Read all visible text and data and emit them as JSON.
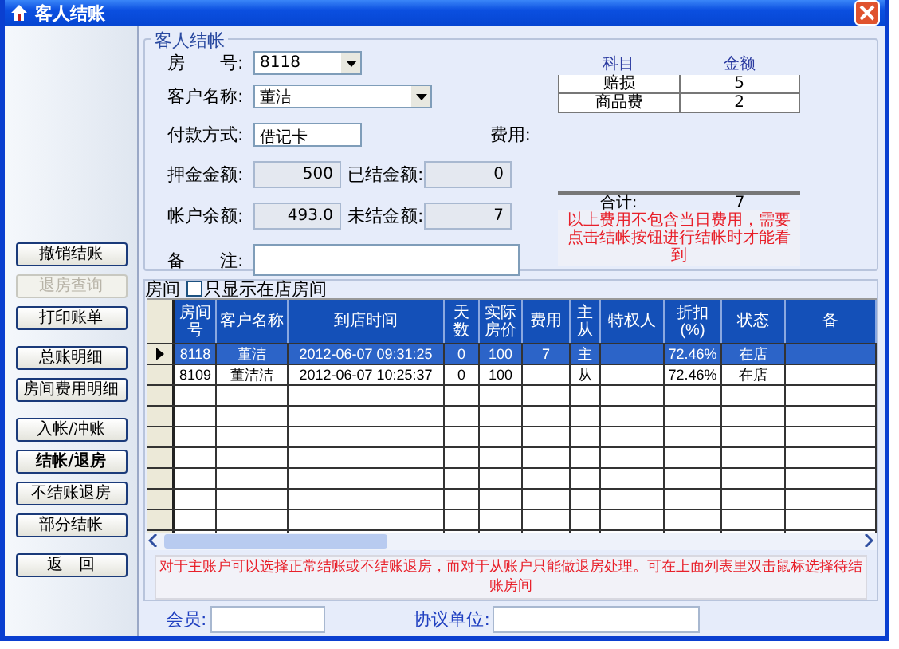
{
  "window": {
    "title": "客人结账"
  },
  "action_groups": [
    [
      {
        "label": "撤销结账",
        "disabled": false,
        "default": false
      },
      {
        "label": "退房查询",
        "disabled": true,
        "default": false
      },
      {
        "label": "打印账单",
        "disabled": false,
        "default": false
      }
    ],
    [
      {
        "label": "总账明细",
        "disabled": false,
        "default": false
      },
      {
        "label": "房间费用明细",
        "disabled": false,
        "default": false
      }
    ],
    [
      {
        "label": "入帐/冲账",
        "disabled": false,
        "default": false
      },
      {
        "label": "结帐/退房",
        "disabled": false,
        "default": true
      },
      {
        "label": "不结账退房",
        "disabled": false,
        "default": false
      },
      {
        "label": "部分结帐",
        "disabled": false,
        "default": false
      }
    ],
    [
      {
        "label": "返　回",
        "disabled": false,
        "default": false
      }
    ]
  ],
  "checkout": {
    "title": "客人结帐",
    "room": {
      "label": "房　　号:",
      "value": "8118"
    },
    "customer": {
      "label": "客户名称:",
      "value": "董洁"
    },
    "payment": {
      "label": "付款方式:",
      "value": "借记卡"
    },
    "fee_label": "费用:",
    "deposit": {
      "label": "押金金额:",
      "value": "500"
    },
    "settled": {
      "label": "已结金额:",
      "value": "0"
    },
    "balance": {
      "label": "帐户余额:",
      "value": "493.0"
    },
    "unsettled": {
      "label": "未结金额:",
      "value": "7"
    },
    "remark": {
      "label": "备　　注:"
    }
  },
  "costs": {
    "columns": [
      "科目",
      "金额"
    ],
    "rows": [
      [
        "赔损",
        "5"
      ],
      [
        "商品费",
        "2"
      ]
    ],
    "total_label": "合计:",
    "total": "7",
    "note": "以上费用不包含当日费用，需要点击结帐按钮进行结帐时才能看到"
  },
  "rooms": {
    "label": "房间",
    "filter": {
      "label": "只显示在店房间",
      "checked": false
    },
    "columns": [
      "房间号",
      "客户名称",
      "到店时间",
      "天数",
      "实际房价",
      "费用",
      "主从",
      "特权人",
      "折扣(%)",
      "状态",
      "备"
    ],
    "rows": [
      {
        "selected": true,
        "current": true,
        "cells": [
          "8118",
          "董洁",
          "2012-06-07 09:31:25",
          "0",
          "100",
          "7",
          "主",
          "",
          "72.46%",
          "在店",
          ""
        ]
      },
      {
        "selected": false,
        "current": false,
        "cells": [
          "8109",
          "董洁洁",
          "2012-06-07 10:25:37",
          "0",
          "100",
          "",
          "从",
          "",
          "72.46%",
          "在店",
          ""
        ]
      }
    ],
    "note": "对于主账户可以选择正常结账或不结账退房，而对于从账户只能做退房处理。可在上面列表里双击鼠标选择待结账房间"
  },
  "member": {
    "label": "会员:"
  },
  "company": {
    "label": "协议单位:"
  }
}
